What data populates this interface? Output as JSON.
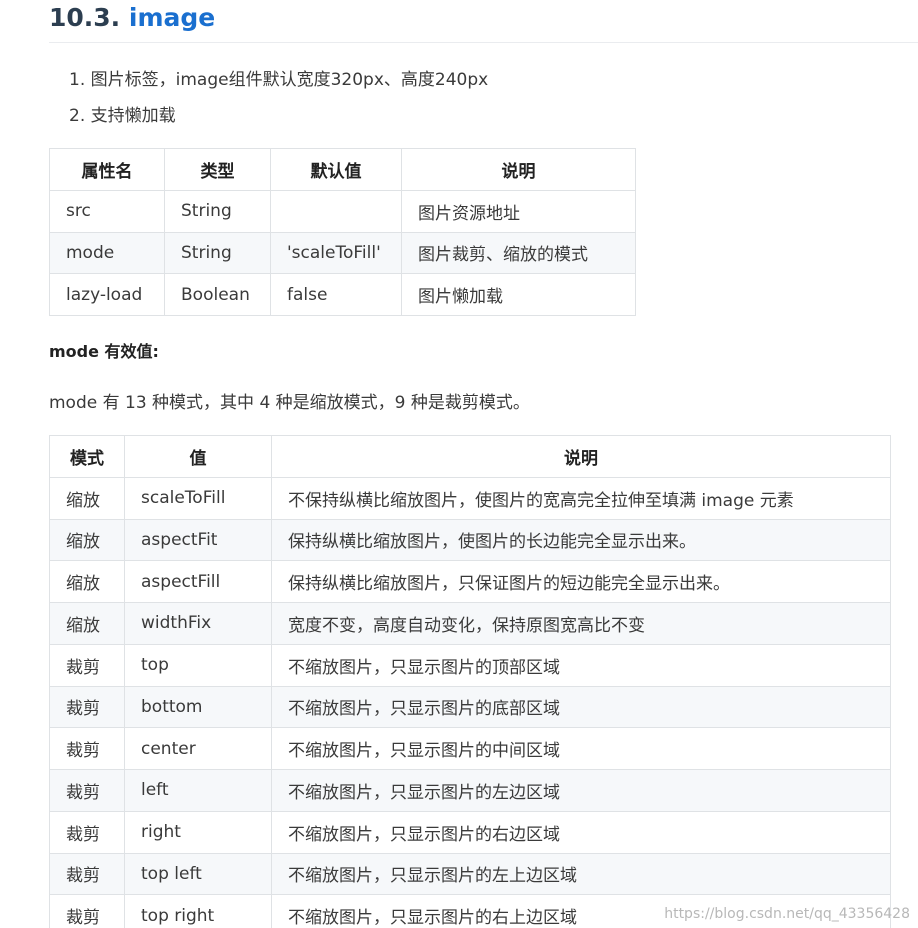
{
  "heading": {
    "number": "10.3.",
    "title": "image"
  },
  "list": [
    "1. 图片标签，image组件默认宽度320px、高度240px",
    "2. 支持懒加载"
  ],
  "attr_table": {
    "headers": [
      "属性名",
      "类型",
      "默认值",
      "说明"
    ],
    "rows": [
      [
        "src",
        "String",
        "",
        "图片资源地址"
      ],
      [
        "mode",
        "String",
        "'scaleToFill'",
        "图片裁剪、缩放的模式"
      ],
      [
        "lazy-load",
        "Boolean",
        "false",
        "图片懒加载"
      ]
    ]
  },
  "subhead": "mode 有效值:",
  "paragraph": "mode 有 13 种模式，其中 4 种是缩放模式，9 种是裁剪模式。",
  "mode_table": {
    "headers": [
      "模式",
      "值",
      "说明"
    ],
    "rows": [
      [
        "缩放",
        "scaleToFill",
        "不保持纵横比缩放图片，使图片的宽高完全拉伸至填满 image 元素"
      ],
      [
        "缩放",
        "aspectFit",
        "保持纵横比缩放图片，使图片的长边能完全显示出来。"
      ],
      [
        "缩放",
        "aspectFill",
        "保持纵横比缩放图片，只保证图片的短边能完全显示出来。"
      ],
      [
        "缩放",
        "widthFix",
        "宽度不变，高度自动变化，保持原图宽高比不变"
      ],
      [
        "裁剪",
        "top",
        "不缩放图片，只显示图片的顶部区域"
      ],
      [
        "裁剪",
        "bottom",
        "不缩放图片，只显示图片的底部区域"
      ],
      [
        "裁剪",
        "center",
        "不缩放图片，只显示图片的中间区域"
      ],
      [
        "裁剪",
        "left",
        "不缩放图片，只显示图片的左边区域"
      ],
      [
        "裁剪",
        "right",
        "不缩放图片，只显示图片的右边区域"
      ],
      [
        "裁剪",
        "top left",
        "不缩放图片，只显示图片的左上边区域"
      ],
      [
        "裁剪",
        "top right",
        "不缩放图片，只显示图片的右上边区域"
      ]
    ]
  },
  "watermark": "https://blog.csdn.net/qq_43356428",
  "colors": {
    "link": "#1a6fcf",
    "text": "#3a3a3a",
    "border": "#dfe2e5",
    "row_alt": "#f6f8fa"
  }
}
